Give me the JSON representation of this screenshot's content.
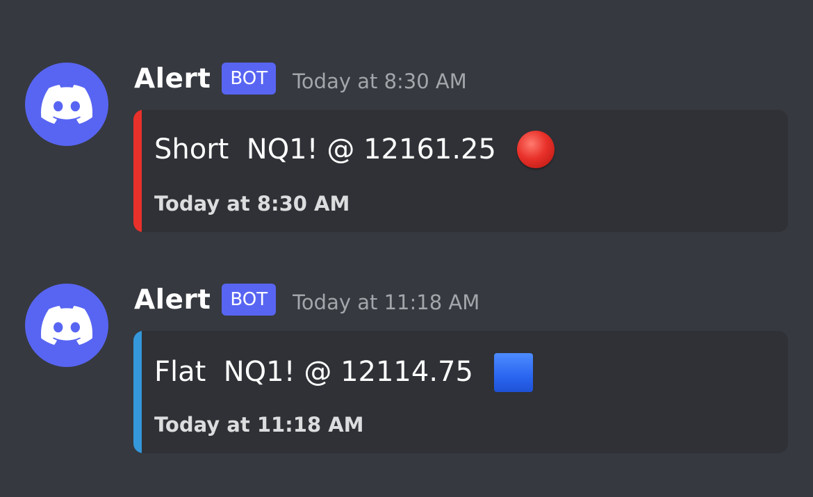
{
  "colors": {
    "background": "#36393f",
    "embed_background": "#2f3136",
    "blurple": "#5865f2",
    "short_bar": "#e8312a",
    "flat_bar": "#3498db"
  },
  "messages": [
    {
      "avatar_icon": "discord-logo-icon",
      "username": "Alert",
      "tag": "BOT",
      "timestamp": "Today at 8:30 AM",
      "embed": {
        "title": "Short  NQ1! @ 12161.25",
        "emoji": "red-circle-icon",
        "footer": "Today at 8:30 AM"
      }
    },
    {
      "avatar_icon": "discord-logo-icon",
      "username": "Alert",
      "tag": "BOT",
      "timestamp": "Today at 11:18 AM",
      "embed": {
        "title": "Flat  NQ1! @ 12114.75",
        "emoji": "blue-square-icon",
        "footer": "Today at 11:18 AM"
      }
    }
  ]
}
